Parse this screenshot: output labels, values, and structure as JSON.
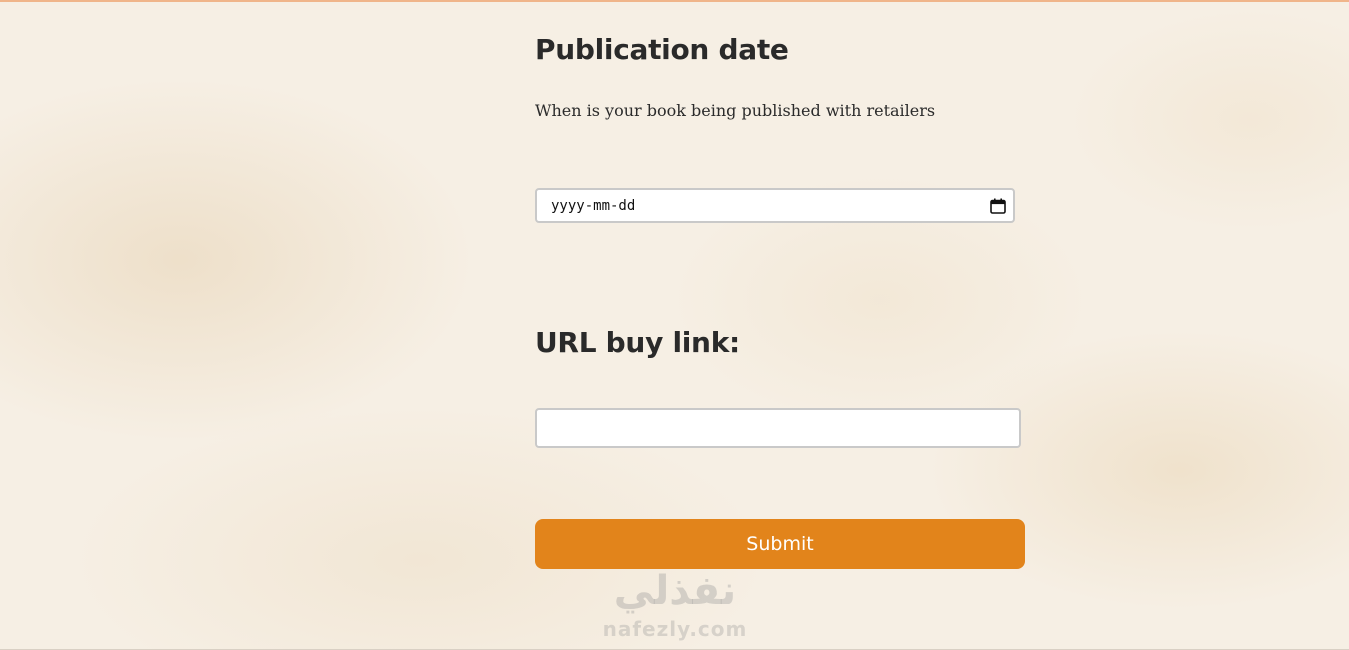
{
  "publication_section": {
    "title": "Publication date",
    "help_text": "When is your book being published with retailers",
    "date_input": {
      "value": "yyyy-mm-dd",
      "icon": "calendar-icon"
    }
  },
  "url_section": {
    "title": "URL buy link:",
    "input": {
      "value": "",
      "placeholder": ""
    }
  },
  "submit": {
    "label": "Submit",
    "color": "#e2841b"
  },
  "watermark": {
    "arabic": "نفذلي",
    "latin": "nafezly.com"
  },
  "colors": {
    "accent": "#e2841b",
    "background": "#f6efe4",
    "top_rule": "#f0b58a",
    "field_border": "#c9c9c9"
  }
}
